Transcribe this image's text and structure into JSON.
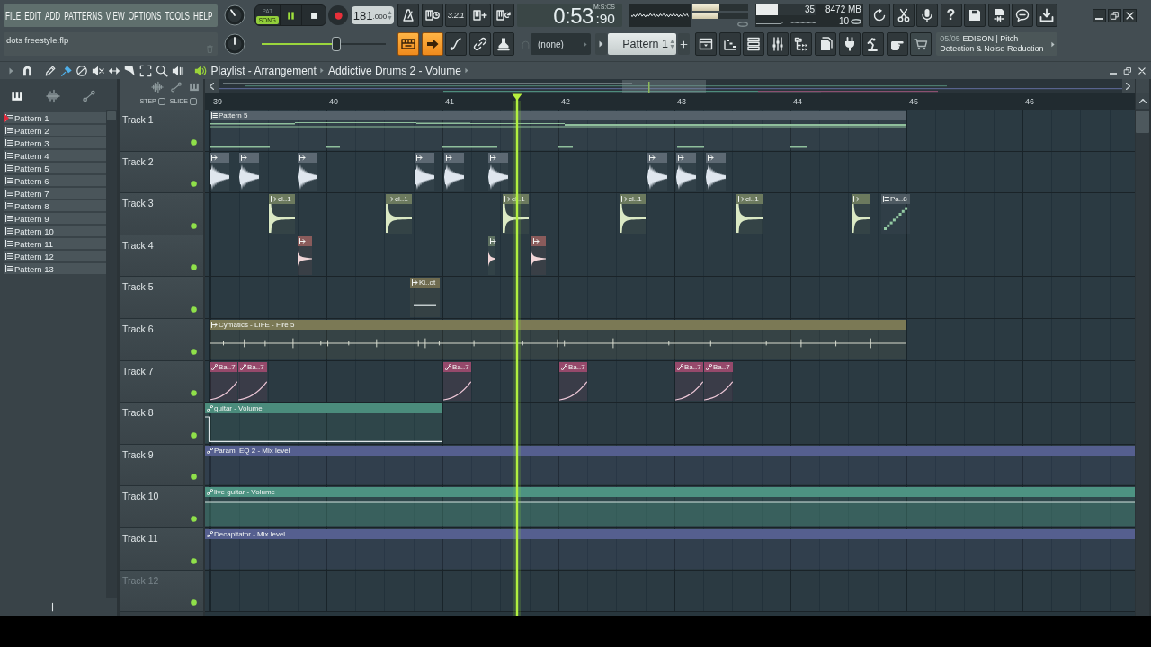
{
  "menu": [
    "FILE",
    "EDIT",
    "ADD",
    "PATTERNS",
    "VIEW",
    "OPTIONS",
    "TOOLS",
    "HELP"
  ],
  "hint_bar": "dots freestyle.flp",
  "transport": {
    "modes": [
      {
        "label": "PAT",
        "selected": false
      },
      {
        "label": "SONG",
        "selected": true
      }
    ],
    "playing": true,
    "tempo": {
      "whole": "181",
      "fraction": ".000"
    }
  },
  "record_options": {
    "countdown_label": "3.2.1"
  },
  "time": {
    "main": "0:53",
    "fraction": ":90",
    "unit": "M:S:CS"
  },
  "output_meter": [
    {
      "level": 0.48
    },
    {
      "level": 0.47
    }
  ],
  "cpu": {
    "level": 0.36,
    "reading": "35",
    "memory": "8472 MB",
    "polyphony": "10"
  },
  "help_label": "?",
  "pitch_slider": {
    "level": 0.6
  },
  "toggles": [
    {
      "kind": "keyboard",
      "on": true
    },
    {
      "kind": "arrow",
      "on": true
    },
    {
      "kind": "curve",
      "on": false
    },
    {
      "kind": "link",
      "on": false
    },
    {
      "kind": "stamp",
      "on": false
    }
  ],
  "selector": "(none)",
  "pattern_selector": "Pattern 1",
  "news": {
    "counter": "05/05",
    "lines": [
      "EDISON | Pitch",
      "Detection & Noise Reduction"
    ]
  },
  "playlist": {
    "title": "Playlist - Arrangement",
    "breadcrumb": "Addictive Drums 2 - Volume",
    "tools": [
      {
        "kind": "pencil",
        "selected": false
      },
      {
        "kind": "brush",
        "selected": true
      },
      {
        "kind": "delete",
        "selected": false
      },
      {
        "kind": "mute",
        "selected": false
      },
      {
        "kind": "slip",
        "selected": false
      },
      {
        "kind": "slice",
        "selected": false
      },
      {
        "kind": "select",
        "selected": false
      },
      {
        "kind": "zoom",
        "selected": false
      },
      {
        "kind": "playback",
        "selected": false
      }
    ]
  },
  "picker": {
    "patterns": [
      {
        "name": "Pattern 1",
        "selected": true
      },
      {
        "name": "Pattern 2",
        "selected": false
      },
      {
        "name": "Pattern 3",
        "selected": false
      },
      {
        "name": "Pattern 4",
        "selected": false
      },
      {
        "name": "Pattern 5",
        "selected": false
      },
      {
        "name": "Pattern 6",
        "selected": false
      },
      {
        "name": "Pattern 7",
        "selected": false
      },
      {
        "name": "Pattern 8",
        "selected": false
      },
      {
        "name": "Pattern 9",
        "selected": false
      },
      {
        "name": "Pattern 10",
        "selected": false
      },
      {
        "name": "Pattern 11",
        "selected": false
      },
      {
        "name": "Pattern 12",
        "selected": false
      },
      {
        "name": "Pattern 13",
        "selected": false
      }
    ]
  },
  "options": [
    {
      "label": "STEP",
      "checked": false
    },
    {
      "label": "SLIDE",
      "checked": false
    }
  ],
  "ruler": [
    "39",
    "40",
    "41",
    "42",
    "43",
    "44",
    "45",
    "46"
  ],
  "tracks": [
    {
      "name": "Track 1",
      "empty": false,
      "enabled": true,
      "clips": [
        {
          "kind": "pattern",
          "label": "Pattern 5",
          "color": "#55616a"
        }
      ]
    },
    {
      "name": "Track 2",
      "empty": false,
      "enabled": true,
      "clips": [
        {
          "kind": "audio",
          "color": "#5d6973"
        },
        {
          "kind": "audio",
          "color": "#5d6973"
        },
        {
          "kind": "audio",
          "color": "#5d6973"
        },
        {
          "kind": "audio",
          "color": "#5d6973"
        },
        {
          "kind": "audio",
          "color": "#5d6973"
        },
        {
          "kind": "audio",
          "color": "#5d6973"
        },
        {
          "kind": "audio",
          "color": "#5d6973"
        },
        {
          "kind": "audio",
          "color": "#5d6973"
        },
        {
          "kind": "audio",
          "color": "#5d6973"
        }
      ]
    },
    {
      "name": "Track 3",
      "empty": false,
      "enabled": true,
      "clips": [
        {
          "kind": "audio",
          "label": "cl..1",
          "color": "#6c7a5e"
        },
        {
          "kind": "audio",
          "label": "cl..1",
          "color": "#6c7a5e"
        },
        {
          "kind": "audio",
          "label": "cl..1",
          "color": "#6c7a5e"
        },
        {
          "kind": "audio",
          "label": "cl..1",
          "color": "#6c7a5e"
        },
        {
          "kind": "audio",
          "label": "cl..1",
          "color": "#6c7a5e"
        },
        {
          "kind": "audio",
          "color": "#6c7a5e"
        },
        {
          "kind": "pattern",
          "label": "Pa..8",
          "color": "#4e5a62"
        }
      ]
    },
    {
      "name": "Track 4",
      "empty": false,
      "enabled": true,
      "clips": [
        {
          "kind": "audio",
          "color": "#8a5b5b"
        },
        {
          "kind": "audio",
          "color": "#5f7262"
        },
        {
          "kind": "audio",
          "color": "#8a5b5b"
        }
      ]
    },
    {
      "name": "Track 5",
      "empty": false,
      "enabled": true,
      "clips": [
        {
          "kind": "audio",
          "label": "Ki..ot",
          "color": "#6f6b50"
        }
      ]
    },
    {
      "name": "Track 6",
      "empty": false,
      "enabled": true,
      "clips": [
        {
          "kind": "audio",
          "label": "Cymatics - LIFE - Fire 5",
          "color": "#7b7955"
        }
      ]
    },
    {
      "name": "Track 7",
      "empty": false,
      "enabled": true,
      "clips": [
        {
          "kind": "automation",
          "label": "Ba..7",
          "color": "#96496b"
        },
        {
          "kind": "automation",
          "label": "Ba..7",
          "color": "#96496b"
        },
        {
          "kind": "automation",
          "label": "Ba..7",
          "color": "#96496b"
        },
        {
          "kind": "automation",
          "label": "Ba..7",
          "color": "#96496b"
        },
        {
          "kind": "automation",
          "label": "Ba..7",
          "color": "#96496b"
        },
        {
          "kind": "automation",
          "label": "Ba..7",
          "color": "#96496b"
        }
      ]
    },
    {
      "name": "Track 8",
      "empty": false,
      "enabled": true,
      "clips": [
        {
          "kind": "automation",
          "label": "guitar - Volume",
          "color": "#4b8c7c"
        }
      ]
    },
    {
      "name": "Track 9",
      "empty": false,
      "enabled": true,
      "clips": [
        {
          "kind": "automation",
          "label": "Param. EQ 2 - Mix level",
          "color": "#555f8f"
        }
      ]
    },
    {
      "name": "Track 10",
      "empty": false,
      "enabled": true,
      "clips": [
        {
          "kind": "automation",
          "label": "live guitar - Volume",
          "color": "#4d9382"
        }
      ]
    },
    {
      "name": "Track 11",
      "empty": false,
      "enabled": true,
      "clips": [
        {
          "kind": "automation",
          "label": "Decapitator - Mix level",
          "color": "#555f8f"
        }
      ]
    },
    {
      "name": "Track 12",
      "empty": true,
      "enabled": true
    }
  ]
}
